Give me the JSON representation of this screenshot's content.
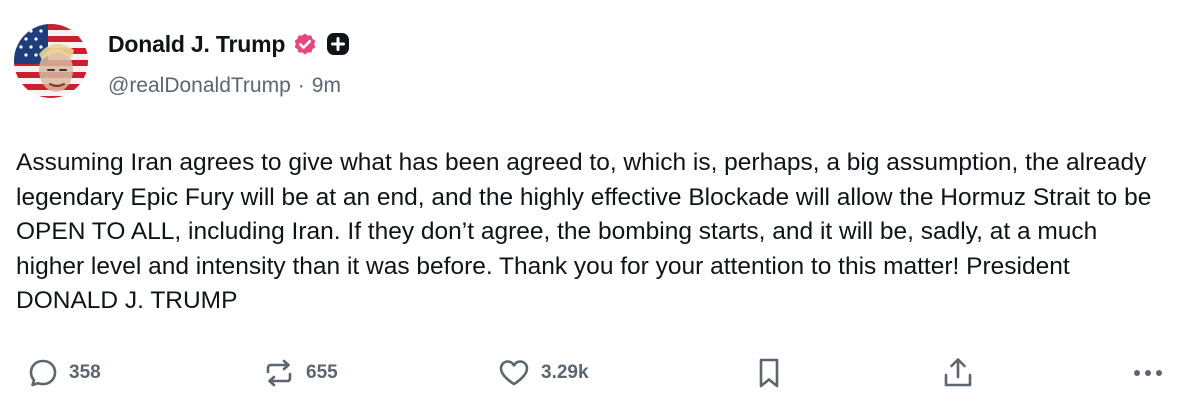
{
  "post": {
    "author": {
      "display_name": "Donald J. Trump",
      "handle": "@realDonaldTrump",
      "verified_icon": "verified-badge-icon",
      "plus_icon": "plus-badge-icon",
      "avatar": "flag-portrait-avatar"
    },
    "separator": "·",
    "timestamp": "9m",
    "text": "Assuming Iran agrees to give what has been agreed to, which is, perhaps, a big assumption, the already legendary Epic Fury will be at an end, and the highly effective Blockade will allow the Hormuz Strait to be OPEN TO ALL, including Iran. If they don’t agree, the bombing starts, and it will be, sadly, at a much higher level and intensity than it was before. Thank you for your attention to this matter! President DONALD J. TRUMP"
  },
  "actions": {
    "reply": {
      "icon": "comment-icon",
      "count": "358"
    },
    "repost": {
      "icon": "repost-icon",
      "count": "655"
    },
    "like": {
      "icon": "heart-icon",
      "count": "3.29k"
    },
    "bookmark": {
      "icon": "bookmark-icon"
    },
    "share": {
      "icon": "share-icon"
    },
    "more": {
      "icon": "more-icon"
    }
  },
  "colors": {
    "verified": "#e8467c",
    "text": "#0f1419",
    "muted": "#5b6670"
  }
}
